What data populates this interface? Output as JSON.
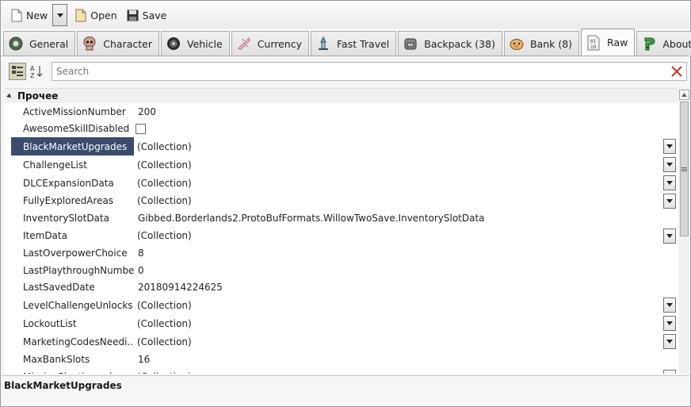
{
  "toolbar": {
    "new_label": "New",
    "open_label": "Open",
    "save_label": "Save"
  },
  "tabs": [
    {
      "label": "General",
      "icon": "gear-icon"
    },
    {
      "label": "Character",
      "icon": "skull-icon"
    },
    {
      "label": "Vehicle",
      "icon": "wheel-icon"
    },
    {
      "label": "Currency",
      "icon": "currency-icon"
    },
    {
      "label": "Fast Travel",
      "icon": "travel-icon"
    },
    {
      "label": "Backpack (38)",
      "icon": "backpack-icon"
    },
    {
      "label": "Bank (8)",
      "icon": "bank-icon"
    },
    {
      "label": "Raw",
      "icon": "binary-icon",
      "active": true
    },
    {
      "label": "About",
      "icon": "question-icon"
    }
  ],
  "search": {
    "placeholder": "Search"
  },
  "grid": {
    "category": "Прочее",
    "rows": [
      {
        "name": "ActiveMissionNumber",
        "value": "200"
      },
      {
        "name": "AwesomeSkillDisabled",
        "value": "",
        "checkbox": true
      },
      {
        "name": "BlackMarketUpgrades",
        "value": "(Collection)",
        "dropdown": true,
        "selected": true
      },
      {
        "name": "ChallengeList",
        "value": "(Collection)",
        "dropdown": true
      },
      {
        "name": "DLCExpansionData",
        "value": "(Collection)",
        "dropdown": true
      },
      {
        "name": "FullyExploredAreas",
        "value": "(Collection)",
        "dropdown": true
      },
      {
        "name": "InventorySlotData",
        "value": "Gibbed.Borderlands2.ProtoBufFormats.WillowTwoSave.InventorySlotData"
      },
      {
        "name": "ItemData",
        "value": "(Collection)",
        "dropdown": true
      },
      {
        "name": "LastOverpowerChoice",
        "value": "8"
      },
      {
        "name": "LastPlaythroughNumber",
        "value": "0"
      },
      {
        "name": "LastSavedDate",
        "value": "20180914224625"
      },
      {
        "name": "LevelChallengeUnlocks",
        "value": "(Collection)",
        "dropdown": true
      },
      {
        "name": "LockoutList",
        "value": "(Collection)",
        "dropdown": true
      },
      {
        "name": "MarketingCodesNeedi...",
        "value": "(Collection)",
        "dropdown": true
      },
      {
        "name": "MaxBankSlots",
        "value": "16"
      },
      {
        "name": "MissionPlaythroughs",
        "value": "(Collection)",
        "dropdown": true
      }
    ]
  },
  "description": {
    "title": "BlackMarketUpgrades"
  },
  "colors": {
    "selection": "#3a4b6e",
    "clear_icon": "#c0392b"
  }
}
